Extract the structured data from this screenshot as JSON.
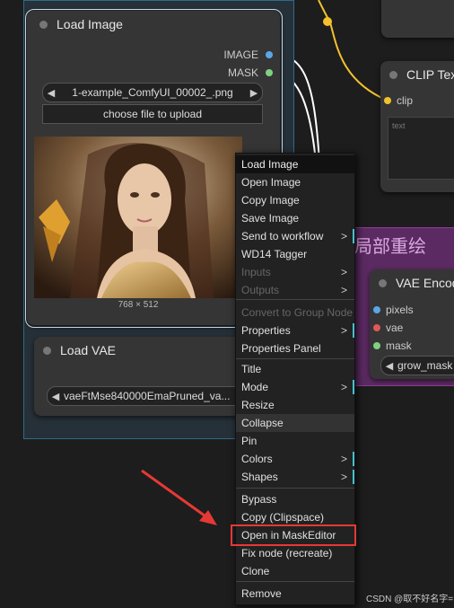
{
  "load_image_node": {
    "title": "Load Image",
    "outputs": [
      "IMAGE",
      "MASK"
    ],
    "image_combo": "1-example_ComfyUI_00002_.png",
    "upload_button": "choose file to upload",
    "image_size": "768 × 512"
  },
  "load_vae_node": {
    "title": "Load VAE",
    "vae_combo": "vaeFtMse840000EmaPruned_va..."
  },
  "clip_node": {
    "title": "CLIP Tex",
    "input_clip": "clip",
    "text_placeholder": "text"
  },
  "group": {
    "title": "局部重绘"
  },
  "vae_encode_node": {
    "title": "VAE Encod",
    "inputs": [
      "pixels",
      "vae",
      "mask"
    ],
    "grow_combo": "grow_mask"
  },
  "context_menu": {
    "items": [
      {
        "label": "Load Image",
        "header": true
      },
      {
        "label": "Open Image"
      },
      {
        "label": "Copy Image"
      },
      {
        "label": "Save Image"
      },
      {
        "label": "Send to workflow",
        "sub": ">"
      },
      {
        "label": "WD14 Tagger"
      },
      {
        "label": "Inputs",
        "disabled": true,
        "sub": ">"
      },
      {
        "label": "Outputs",
        "disabled": true,
        "sub": ">"
      },
      {
        "label": "Convert to Group Node",
        "disabled": true
      },
      {
        "label": "Properties",
        "sub": ">"
      },
      {
        "label": "Properties Panel"
      },
      {
        "label": "Title"
      },
      {
        "label": "Mode",
        "sub": ">"
      },
      {
        "label": "Resize"
      },
      {
        "label": "Collapse",
        "hover": true
      },
      {
        "label": "Pin"
      },
      {
        "label": "Colors",
        "sub": ">"
      },
      {
        "label": "Shapes",
        "sub": ">"
      },
      {
        "label": "Bypass"
      },
      {
        "label": "Copy (Clipspace)"
      },
      {
        "label": "Open in MaskEditor",
        "highlighted": true
      },
      {
        "label": "Fix node (recreate)"
      },
      {
        "label": "Clone"
      },
      {
        "label": "Remove"
      }
    ],
    "sub_arrow": ">"
  },
  "watermark": "CSDN @取不好名字=",
  "colors": {
    "image_port": "#5aa7e6",
    "mask_port": "#7fd27f",
    "clip_port": "#f2c12e",
    "vae_port": "#e05858",
    "highlight_red": "#e53935",
    "group_purple": "#5b2a62"
  }
}
